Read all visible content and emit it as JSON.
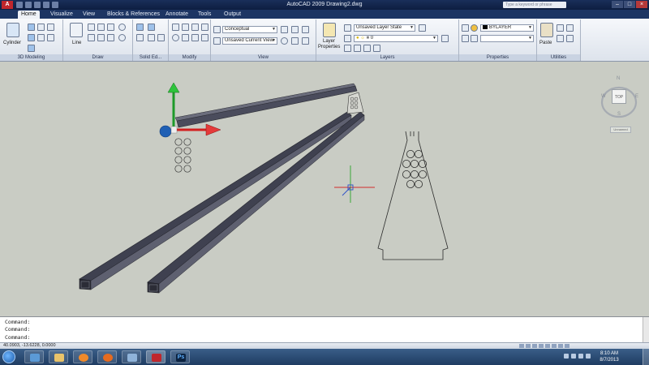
{
  "window": {
    "title": "AutoCAD 2009  Drawing2.dwg",
    "search_placeholder": "Type a keyword or phrase",
    "logo": "A"
  },
  "tabs": [
    "Home",
    "Visualize",
    "View",
    "Blocks & References",
    "Annotate",
    "Tools",
    "Output"
  ],
  "ribbon": {
    "modeling": {
      "title": "3D Modeling",
      "cylinder_label": "Cylinder"
    },
    "draw": {
      "title": "Draw",
      "line_label": "Line"
    },
    "solid_edit": {
      "title": "Solid Ed..."
    },
    "modify": {
      "title": "Modify"
    },
    "view": {
      "title": "View",
      "visual_style": "Conceptual",
      "current_view": "Unsaved Current View"
    },
    "layers": {
      "title": "Layers",
      "layer_properties_label_1": "Layer",
      "layer_properties_label_2": "Properties",
      "layer_state": "Unsaved Layer State",
      "current_layer": "0"
    },
    "properties": {
      "title": "Properties",
      "color": "BYLAYER"
    },
    "utilities": {
      "title": "Utilities",
      "paste_label": "Paste"
    }
  },
  "viewport": {
    "ucs_y_label": "Y",
    "viewcube": {
      "face": "TOP",
      "n": "N",
      "s": "S",
      "w": "W",
      "e": "E"
    },
    "wcs_label": "Unnamed"
  },
  "command_line": {
    "lines": [
      "Command:",
      "Command:",
      "Command:"
    ]
  },
  "status_bar": {
    "coords": "40.0903,  -13.6228,  0.0000"
  },
  "taskbar": {
    "time": "8:10 AM",
    "date": "8/7/2013",
    "ps_label": "Ps"
  },
  "colors": {
    "viewport_bg": "#c9ccc4",
    "beam_dark": "#3f4150",
    "beam_mid": "#5e6070",
    "axis_y": "#1e9a2a",
    "axis_x": "#d22020",
    "axis_z": "#1f5fb4",
    "cursor_red": "#d42c2c",
    "cursor_green": "#2aa52a",
    "cursor_blue": "#2a4ec8"
  }
}
